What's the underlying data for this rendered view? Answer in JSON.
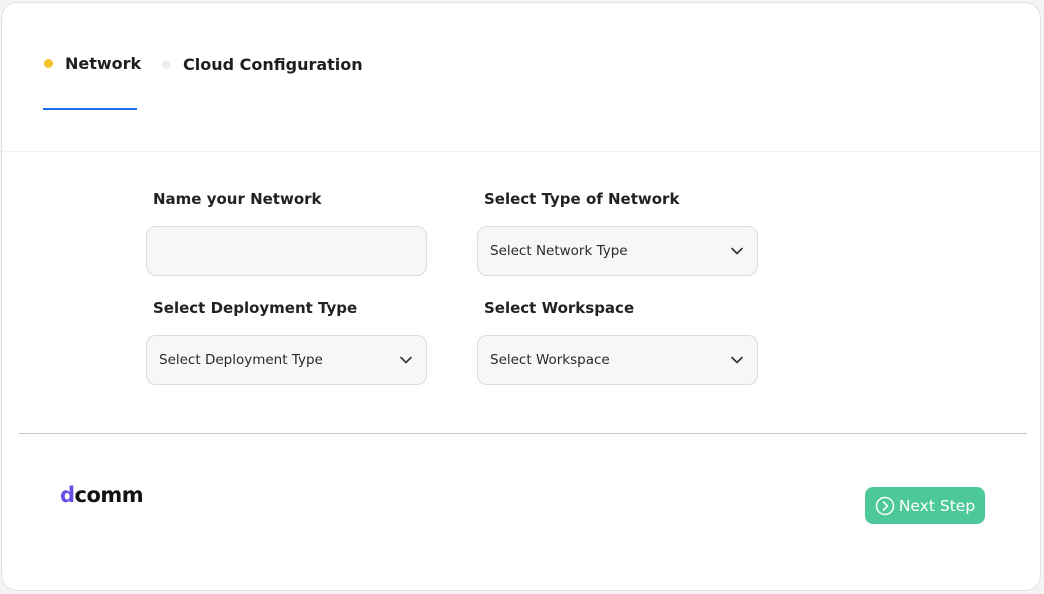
{
  "tabs": [
    {
      "label": "Network",
      "dot_color": "#f6c22b",
      "active": true
    },
    {
      "label": "Cloud Configuration",
      "dot_color": "#eeeeee",
      "active": false
    }
  ],
  "colors": {
    "accent": "#1a73e8",
    "button": "#4dc89a",
    "active_dot": "#f6c22b"
  },
  "form": {
    "network_name": {
      "label": "Name your Network",
      "value": "",
      "placeholder": ""
    },
    "network_type": {
      "label": "Select Type of Network",
      "selected": "Select Network Type",
      "icon": "chevron-down-icon"
    },
    "deployment_type": {
      "label": "Select Deployment Type",
      "selected": "Select Deployment Type",
      "icon": "chevron-down-icon"
    },
    "workspace": {
      "label": "Select Workspace",
      "selected": "Select Workspace",
      "icon": "chevron-down-icon"
    }
  },
  "footer": {
    "logo_text": "dcomm",
    "next_button": {
      "label": "Next Step",
      "icon": "chevron-right-circle-icon"
    }
  }
}
